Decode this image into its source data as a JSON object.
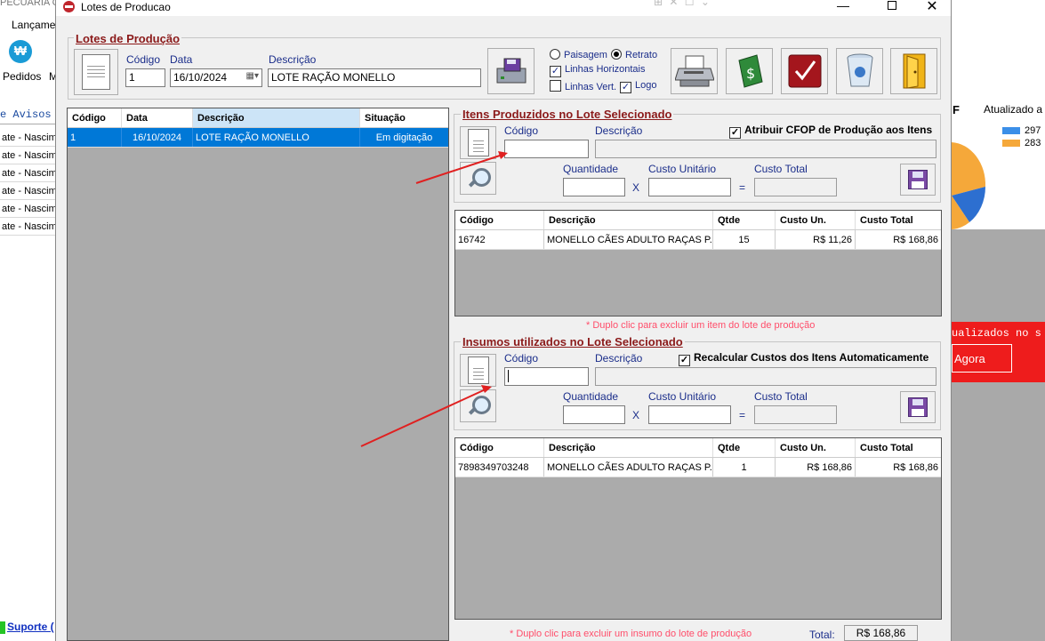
{
  "bg": {
    "title": "PECUARIA C",
    "menu": "Lançame",
    "pedidos": "Pedidos",
    "m": "M",
    "avisos": "e Avisos",
    "notices": [
      "ate - Nascime",
      "ate - Nascime",
      "ate - Nascime",
      "ate - Nascime",
      "ate - Nascime",
      "ate - Nascime"
    ],
    "suporte": "Suporte (",
    "chart_title": "F",
    "updated": "Atualizado a",
    "legend": [
      {
        "value": "297",
        "color": "#3b8fe8"
      },
      {
        "value": "283",
        "color": "#f5a83a"
      }
    ],
    "red_text": "ualizados no s",
    "agora": "Agora"
  },
  "window": {
    "title": "Lotes de Producao",
    "faded_tools": "⊞ ✕ ☐ ⌄",
    "minimize": "—",
    "close": "✕"
  },
  "lote": {
    "section": "Lotes de Produção",
    "codigo_label": "Código",
    "codigo": "1",
    "data_label": "Data",
    "data": "16/10/2024",
    "descricao_label": "Descrição",
    "descricao": "LOTE RAÇÃO MONELLO",
    "paisagem": "Paisagem",
    "retrato": "Retrato",
    "linhas_h": "Linhas Horizontais",
    "linhas_v": "Linhas Vert.",
    "logo": "Logo"
  },
  "lotes_grid": {
    "headers": [
      "Código",
      "Data",
      "Descrição",
      "Situação"
    ],
    "rows": [
      [
        "1",
        "16/10/2024",
        "LOTE RAÇÃO MONELLO",
        "Em digitação"
      ]
    ]
  },
  "itens": {
    "section": "Itens Produzidos no Lote Selecionado",
    "codigo_label": "Código",
    "descricao_label": "Descrição",
    "atribuir": "Atribuir CFOP de Produção aos Itens",
    "quantidade_label": "Quantidade",
    "custo_unit_label": "Custo Unitário",
    "custo_total_label": "Custo Total",
    "x": "X",
    "eq": "=",
    "headers": [
      "Código",
      "Descrição",
      "Qtde",
      "Custo Un.",
      "Custo Total"
    ],
    "rows": [
      [
        "16742",
        "MONELLO CÃES ADULTO RAÇAS P...",
        "15",
        "R$ 11,26",
        "R$ 168,86"
      ]
    ],
    "hint": "* Duplo clic para excluir um item do lote de produção"
  },
  "insumos": {
    "section": "Insumos utilizados no Lote Selecionado",
    "codigo_label": "Código",
    "descricao_label": "Descrição",
    "recalcular": "Recalcular Custos dos Itens Automaticamente",
    "quantidade_label": "Quantidade",
    "custo_unit_label": "Custo Unitário",
    "custo_total_label": "Custo Total",
    "x": "X",
    "eq": "=",
    "headers": [
      "Código",
      "Descrição",
      "Qtde",
      "Custo Un.",
      "Custo Total"
    ],
    "rows": [
      [
        "7898349703248",
        "MONELLO CÃES ADULTO RAÇAS P...",
        "1",
        "R$ 168,86",
        "R$ 168,86"
      ]
    ],
    "hint": "* Duplo clic para excluir um insumo do lote de produção",
    "total_label": "Total:",
    "total": "R$ 168,86"
  }
}
